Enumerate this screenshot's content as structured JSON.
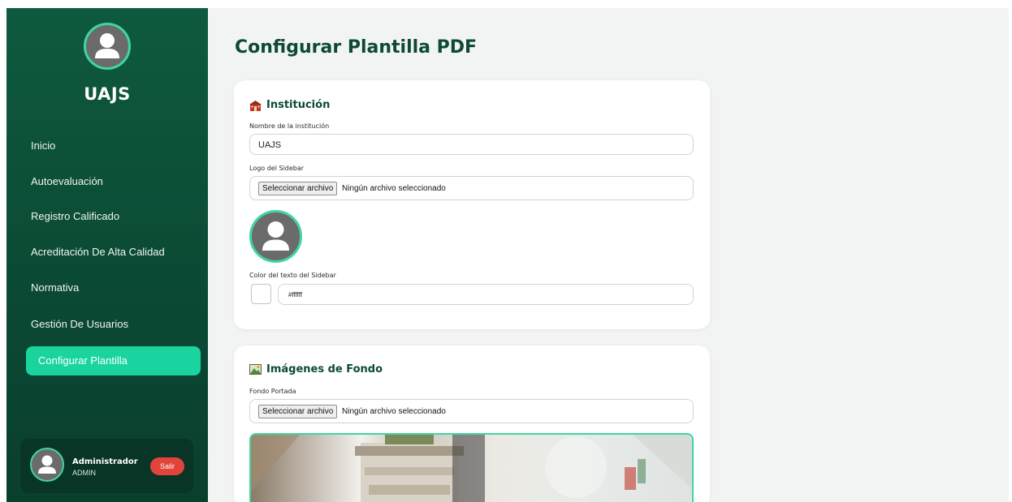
{
  "sidebar": {
    "brand": "UAJS",
    "items": [
      {
        "label": "Inicio"
      },
      {
        "label": "Autoevaluación"
      },
      {
        "label": "Registro Calificado"
      },
      {
        "label": "Acreditación De Alta Calidad"
      },
      {
        "label": "Normativa"
      },
      {
        "label": "Gestión De Usuarios"
      },
      {
        "label": "Configurar Plantilla",
        "active": true
      }
    ],
    "user": {
      "name": "Administrador",
      "role": "ADMIN",
      "logout_label": "Salir"
    }
  },
  "main": {
    "title": "Configurar Plantilla PDF",
    "institution_card": {
      "icon": "school-building-icon",
      "title": "Institución",
      "name_label": "Nombre de la institución",
      "name_value": "UAJS",
      "logo_label": "Logo del Sidebar",
      "file_button": "Seleccionar archivo",
      "file_status": "Ningún archivo seleccionado",
      "color_label": "Color del texto del Sidebar",
      "color_value": "#ffffff"
    },
    "background_card": {
      "icon": "picture-icon",
      "title": "Imágenes de Fondo",
      "cover_label": "Fondo Portada",
      "file_button": "Seleccionar archivo",
      "file_status": "Ningún archivo seleccionado"
    }
  },
  "colors": {
    "sidebar": "#0b4a34",
    "accent": "#1ad4a0",
    "title": "#0d4a33",
    "logout": "#e3443a"
  }
}
